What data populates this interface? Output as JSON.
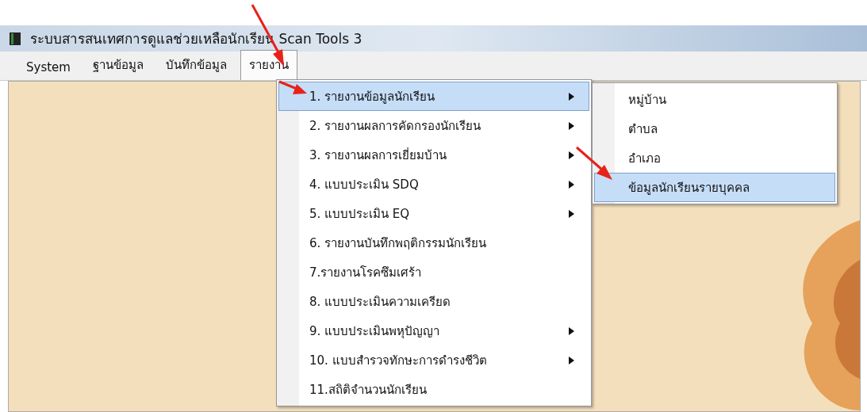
{
  "window": {
    "title": "ระบบสารสนเทศการดูแลช่วยเหลือนักเรียน Scan Tools 3"
  },
  "menu_bar": [
    {
      "label": "System",
      "selected": false
    },
    {
      "label": "ฐานข้อมูล",
      "selected": false
    },
    {
      "label": "บันทึกข้อมูล",
      "selected": false
    },
    {
      "label": "รายงาน",
      "selected": true
    }
  ],
  "dropdown": [
    {
      "label": "1. รายงานข้อมูลนักเรียน",
      "has_submenu": true,
      "selected": true
    },
    {
      "label": "2. รายงานผลการคัดกรองนักเรียน",
      "has_submenu": true,
      "selected": false
    },
    {
      "label": "3. รายงานผลการเยี่ยมบ้าน",
      "has_submenu": true,
      "selected": false
    },
    {
      "label": "4. แบบประเมิน SDQ",
      "has_submenu": true,
      "selected": false
    },
    {
      "label": "5. แบบประเมิน EQ",
      "has_submenu": true,
      "selected": false
    },
    {
      "label": "6. รายงานบันทึกพฤติกรรมนักเรียน",
      "has_submenu": false,
      "selected": false
    },
    {
      "label": "7.รายงานโรคซึมเศร้า",
      "has_submenu": false,
      "selected": false
    },
    {
      "label": "8. แบบประเมินความเครียด",
      "has_submenu": false,
      "selected": false
    },
    {
      "label": "9. แบบประเมินพหุปัญญา",
      "has_submenu": true,
      "selected": false
    },
    {
      "label": "10. แบบสำรวจทักษะการดำรงชีวิต",
      "has_submenu": true,
      "selected": false
    },
    {
      "label": "11.สถิติจำนวนนักเรียน",
      "has_submenu": false,
      "selected": false
    }
  ],
  "submenu": [
    {
      "label": "หมู่บ้าน",
      "selected": false
    },
    {
      "label": "ตำบล",
      "selected": false
    },
    {
      "label": "อำเภอ",
      "selected": false
    },
    {
      "label": "ข้อมูลนักเรียนรายบุคคล",
      "selected": true
    }
  ]
}
